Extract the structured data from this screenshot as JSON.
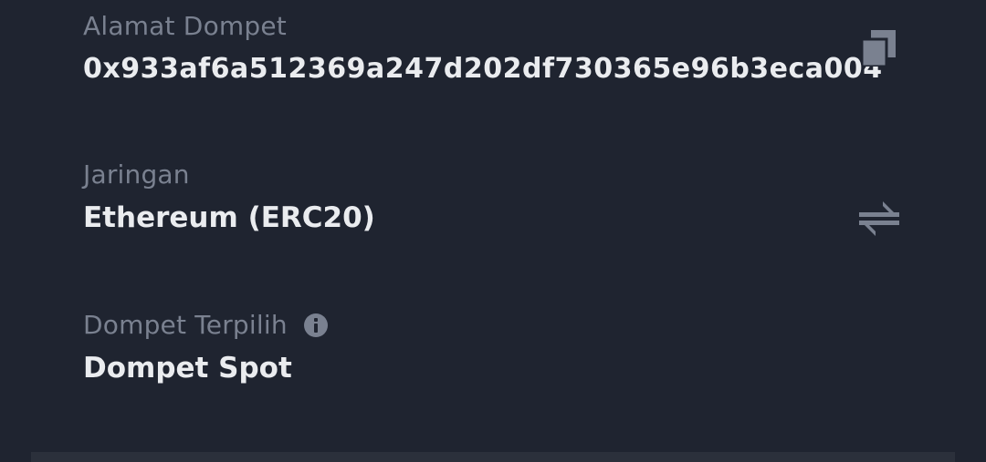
{
  "address": {
    "label": "Alamat Dompet",
    "value": "0x933af6a512369a247d202df730365e96b3eca004",
    "action_icon": "copy-icon"
  },
  "network": {
    "label": "Jaringan",
    "value": "Ethereum (ERC20)",
    "action_icon": "swap-arrows-icon"
  },
  "wallet": {
    "label": "Dompet Terpilih",
    "value": "Dompet Spot",
    "info_icon": "info-icon"
  },
  "colors": {
    "background": "#1f2430",
    "label": "#7a8190",
    "value": "#eaecef",
    "icon": "#7a8190"
  }
}
